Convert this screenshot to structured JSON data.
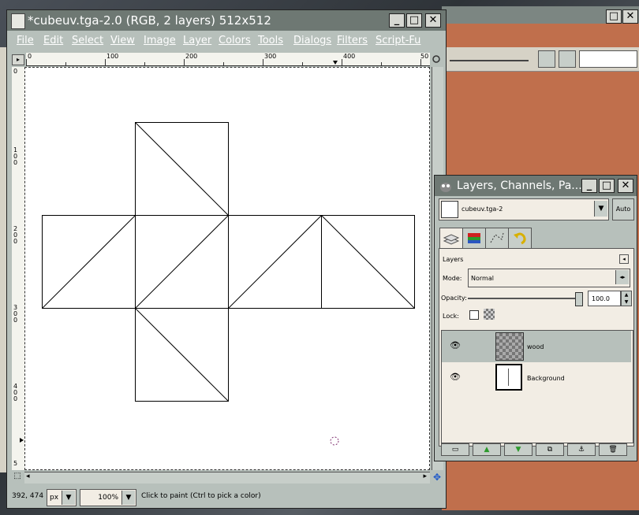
{
  "main_window": {
    "title": "*cubeuv.tga-2.0 (RGB, 2 layers) 512x512",
    "menu": [
      "File",
      "Edit",
      "Select",
      "View",
      "Image",
      "Layer",
      "Colors",
      "Tools",
      "Dialogs",
      "Filters",
      "Script-Fu"
    ],
    "ruler_top_ticks": [
      "0",
      "100",
      "200",
      "300",
      "400",
      "50"
    ],
    "ruler_left_ticks": [
      "0",
      "100",
      "200",
      "300",
      "400",
      "5"
    ],
    "status": {
      "coords": "392, 474",
      "unit": "px",
      "zoom": "100%",
      "message": "Click to paint (Ctrl to pick a color)"
    }
  },
  "layers_dialog": {
    "title": "Layers, Channels, Pa...",
    "image_selector": "cubeuv.tga-2",
    "auto_label": "Auto",
    "section_label": "Layers",
    "mode_label": "Mode:",
    "mode_value": "Normal",
    "opacity_label": "Opacity:",
    "opacity_value": "100.0",
    "lock_label": "Lock:",
    "layers": [
      {
        "name": "wood"
      },
      {
        "name": "Background"
      }
    ]
  }
}
